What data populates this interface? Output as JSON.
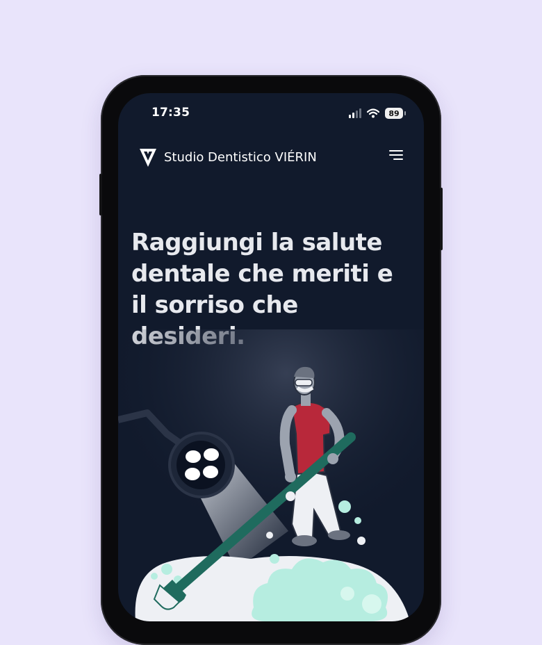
{
  "status_bar": {
    "time": "17:35",
    "battery": "89",
    "signal_icon": "signal-bars-icon",
    "wifi_icon": "wifi-icon"
  },
  "header": {
    "brand": "Studio Dentistico VIÉRIN",
    "logo_icon": "vierin-logo-icon",
    "menu_icon": "hamburger-menu-icon"
  },
  "hero": {
    "headline": "Raggiungi la salute dentale che meriti e il sorriso che desideri."
  },
  "colors": {
    "background": "#e9e4fb",
    "screen": "#111a2c",
    "text": "#e7e9ee",
    "accent_green": "#1f6b5e",
    "shirt_red": "#b8283a",
    "foam_mint": "#b6ede0"
  }
}
